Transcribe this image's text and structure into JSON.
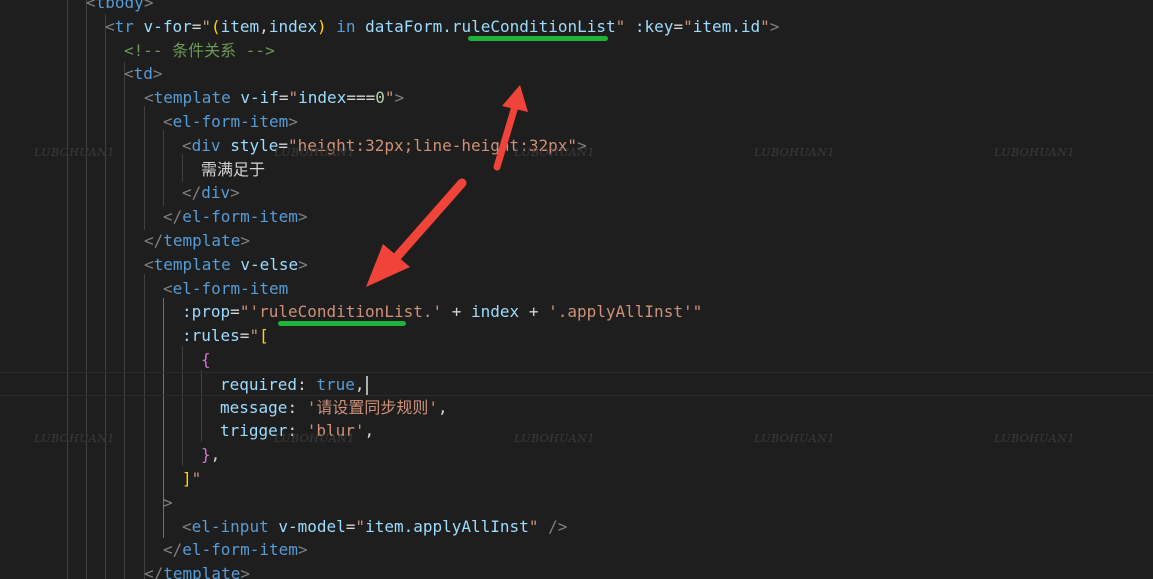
{
  "editor": {
    "theme": "dark",
    "background_color": "#1e1e1e",
    "lines": [
      {
        "tokens": [
          [
            "punc",
            "<"
          ],
          [
            "tag",
            "tbody"
          ],
          [
            "punc",
            ">"
          ]
        ]
      },
      {
        "tokens": [
          [
            "punc",
            "<"
          ],
          [
            "tag",
            "tr"
          ],
          [
            "text",
            " "
          ],
          [
            "attr",
            "v-for"
          ],
          [
            "op",
            "="
          ],
          [
            "str",
            "\""
          ],
          [
            "paren",
            "("
          ],
          [
            "expr",
            "item"
          ],
          [
            "op",
            ","
          ],
          [
            "expr",
            "index"
          ],
          [
            "paren",
            ")"
          ],
          [
            "text",
            " "
          ],
          [
            "kw",
            "in"
          ],
          [
            "text",
            " "
          ],
          [
            "expr",
            "dataForm.ruleConditionList"
          ],
          [
            "str",
            "\""
          ],
          [
            "text",
            " "
          ],
          [
            "attr",
            ":key"
          ],
          [
            "op",
            "="
          ],
          [
            "str",
            "\""
          ],
          [
            "expr",
            "item.id"
          ],
          [
            "str",
            "\""
          ],
          [
            "punc",
            ">"
          ]
        ]
      },
      {
        "tokens": [
          [
            "cmt",
            "<!-- 条件关系 -->"
          ]
        ]
      },
      {
        "tokens": [
          [
            "punc",
            "<"
          ],
          [
            "tag",
            "td"
          ],
          [
            "punc",
            ">"
          ]
        ]
      },
      {
        "tokens": [
          [
            "punc",
            "<"
          ],
          [
            "tag",
            "template"
          ],
          [
            "text",
            " "
          ],
          [
            "attr",
            "v-if"
          ],
          [
            "op",
            "="
          ],
          [
            "str",
            "\""
          ],
          [
            "expr",
            "index"
          ],
          [
            "op",
            "==="
          ],
          [
            "num",
            "0"
          ],
          [
            "str",
            "\""
          ],
          [
            "punc",
            ">"
          ]
        ]
      },
      {
        "tokens": [
          [
            "punc",
            "<"
          ],
          [
            "tag",
            "el-form-item"
          ],
          [
            "punc",
            ">"
          ]
        ]
      },
      {
        "tokens": [
          [
            "punc",
            "<"
          ],
          [
            "tag",
            "div"
          ],
          [
            "text",
            " "
          ],
          [
            "attr",
            "style"
          ],
          [
            "op",
            "="
          ],
          [
            "str",
            "\"height:32px;line-height:32px\""
          ],
          [
            "punc",
            ">"
          ]
        ]
      },
      {
        "tokens": [
          [
            "text",
            "需满足于"
          ]
        ]
      },
      {
        "tokens": [
          [
            "punc",
            "</"
          ],
          [
            "tag",
            "div"
          ],
          [
            "punc",
            ">"
          ]
        ]
      },
      {
        "tokens": [
          [
            "punc",
            "</"
          ],
          [
            "tag",
            "el-form-item"
          ],
          [
            "punc",
            ">"
          ]
        ]
      },
      {
        "tokens": [
          [
            "punc",
            "</"
          ],
          [
            "tag",
            "template"
          ],
          [
            "punc",
            ">"
          ]
        ]
      },
      {
        "tokens": [
          [
            "punc",
            "<"
          ],
          [
            "tag",
            "template"
          ],
          [
            "text",
            " "
          ],
          [
            "attr",
            "v-else"
          ],
          [
            "punc",
            ">"
          ]
        ]
      },
      {
        "tokens": [
          [
            "punc",
            "<"
          ],
          [
            "tag",
            "el-form-item"
          ]
        ]
      },
      {
        "tokens": [
          [
            "attr",
            ":prop"
          ],
          [
            "op",
            "="
          ],
          [
            "str",
            "\""
          ],
          [
            "str",
            "'ruleConditionList.'"
          ],
          [
            "op",
            " + "
          ],
          [
            "expr",
            "index"
          ],
          [
            "op",
            " + "
          ],
          [
            "str",
            "'.applyAllInst'"
          ],
          [
            "str",
            "\""
          ]
        ]
      },
      {
        "tokens": [
          [
            "attr",
            ":rules"
          ],
          [
            "op",
            "="
          ],
          [
            "str",
            "\""
          ],
          [
            "paren",
            "["
          ]
        ]
      },
      {
        "tokens": [
          [
            "brace",
            "{"
          ]
        ]
      },
      {
        "tokens": [
          [
            "expr",
            "required"
          ],
          [
            "op",
            ": "
          ],
          [
            "bool",
            "true"
          ],
          [
            "op",
            ","
          ]
        ]
      },
      {
        "tokens": [
          [
            "expr",
            "message"
          ],
          [
            "op",
            ": "
          ],
          [
            "str",
            "'请设置同步规则'"
          ],
          [
            "op",
            ","
          ]
        ]
      },
      {
        "tokens": [
          [
            "expr",
            "trigger"
          ],
          [
            "op",
            ": "
          ],
          [
            "str",
            "'blur'"
          ],
          [
            "op",
            ","
          ]
        ]
      },
      {
        "tokens": [
          [
            "brace",
            "}"
          ],
          [
            "op",
            ","
          ]
        ]
      },
      {
        "tokens": [
          [
            "paren",
            "]"
          ],
          [
            "str",
            "\""
          ]
        ]
      },
      {
        "tokens": [
          [
            "punc",
            ">"
          ]
        ]
      },
      {
        "tokens": [
          [
            "punc",
            "<"
          ],
          [
            "tag",
            "el-input"
          ],
          [
            "text",
            " "
          ],
          [
            "attr",
            "v-model"
          ],
          [
            "op",
            "="
          ],
          [
            "str",
            "\""
          ],
          [
            "expr",
            "item.applyAllInst"
          ],
          [
            "str",
            "\""
          ],
          [
            "text",
            " "
          ],
          [
            "punc",
            "/>"
          ]
        ]
      },
      {
        "tokens": [
          [
            "punc",
            "</"
          ],
          [
            "tag",
            "el-form-item"
          ],
          [
            "punc",
            ">"
          ]
        ]
      },
      {
        "tokens": [
          [
            "punc",
            "</"
          ],
          [
            "tag",
            "template"
          ],
          [
            "punc",
            ">"
          ]
        ]
      }
    ]
  },
  "watermark": {
    "text": "LUBOHUAN1"
  },
  "annotations": {
    "underline_color": "#1fb33a",
    "arrow_color": "#f0443a"
  }
}
